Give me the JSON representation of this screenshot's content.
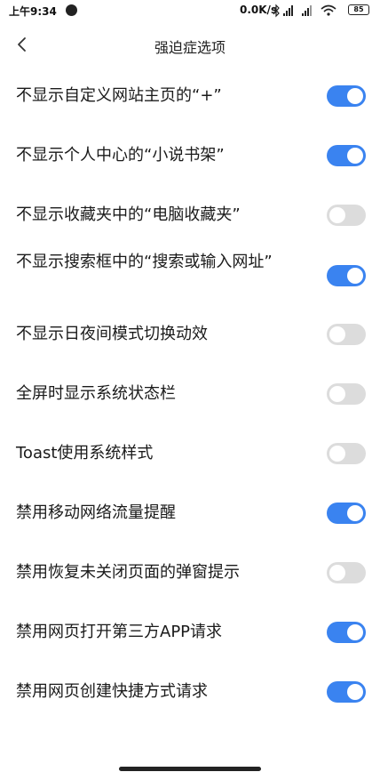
{
  "status_bar": {
    "time": "上午9:34",
    "net_speed": "0.0K/s",
    "battery": "85"
  },
  "header": {
    "title": "强迫症选项"
  },
  "settings": [
    {
      "label": "不显示自定义网站主页的“+”",
      "enabled": true
    },
    {
      "label": "不显示个人中心的“小说书架”",
      "enabled": true
    },
    {
      "label": "不显示收藏夹中的“电脑收藏夹”",
      "enabled": false
    },
    {
      "label": "不显示搜索框中的“搜索或输入网址”",
      "enabled": true
    },
    {
      "label": "不显示日夜间模式切换动效",
      "enabled": false
    },
    {
      "label": "全屏时显示系统状态栏",
      "enabled": false
    },
    {
      "label": "Toast使用系统样式",
      "enabled": false
    },
    {
      "label": "禁用移动网络流量提醒",
      "enabled": true
    },
    {
      "label": "禁用恢复未关闭页面的弹窗提示",
      "enabled": false
    },
    {
      "label": "禁用网页打开第三方APP请求",
      "enabled": true
    },
    {
      "label": "禁用网页创建快捷方式请求",
      "enabled": true
    }
  ],
  "colors": {
    "toggle_on": "#3a83f0",
    "toggle_off": "#dcdcdc"
  }
}
